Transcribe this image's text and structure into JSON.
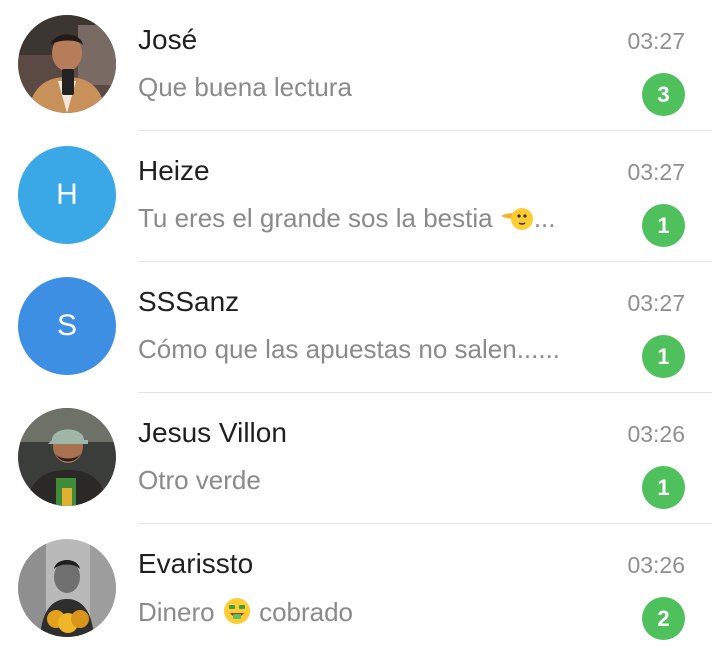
{
  "chats": [
    {
      "name": "José",
      "time": "03:27",
      "preview": "Que buena lectura",
      "unread": "3",
      "avatar": {
        "type": "photo",
        "icon": "person-photo-icon"
      }
    },
    {
      "name": "Heize",
      "time": "03:27",
      "preview": "Tu eres el grande sos la bestia",
      "preview_suffix": "...",
      "preview_emoji": "point-left-face-emoji",
      "unread": "1",
      "avatar": {
        "type": "letter",
        "letter": "H",
        "color": "#3aa7e6"
      }
    },
    {
      "name": "SSSanz",
      "time": "03:27",
      "preview": "Cómo que las apuestas no salen......",
      "unread": "1",
      "avatar": {
        "type": "letter",
        "letter": "S",
        "color": "#3d8fe4"
      }
    },
    {
      "name": "Jesus Villon",
      "time": "03:26",
      "preview": "Otro verde",
      "unread": "1",
      "avatar": {
        "type": "photo",
        "icon": "person-photo-icon"
      }
    },
    {
      "name": "Evarissto",
      "time": "03:26",
      "preview_before": "Dinero",
      "preview_emoji": "money-mouth-face-emoji",
      "preview_after": "cobrado",
      "unread": "2",
      "avatar": {
        "type": "photo",
        "icon": "person-photo-icon"
      }
    }
  ],
  "colors": {
    "badge": "#4fc15c",
    "name": "#1f1f1f",
    "preview": "#8a8a8a",
    "time": "#8f8f8f"
  }
}
